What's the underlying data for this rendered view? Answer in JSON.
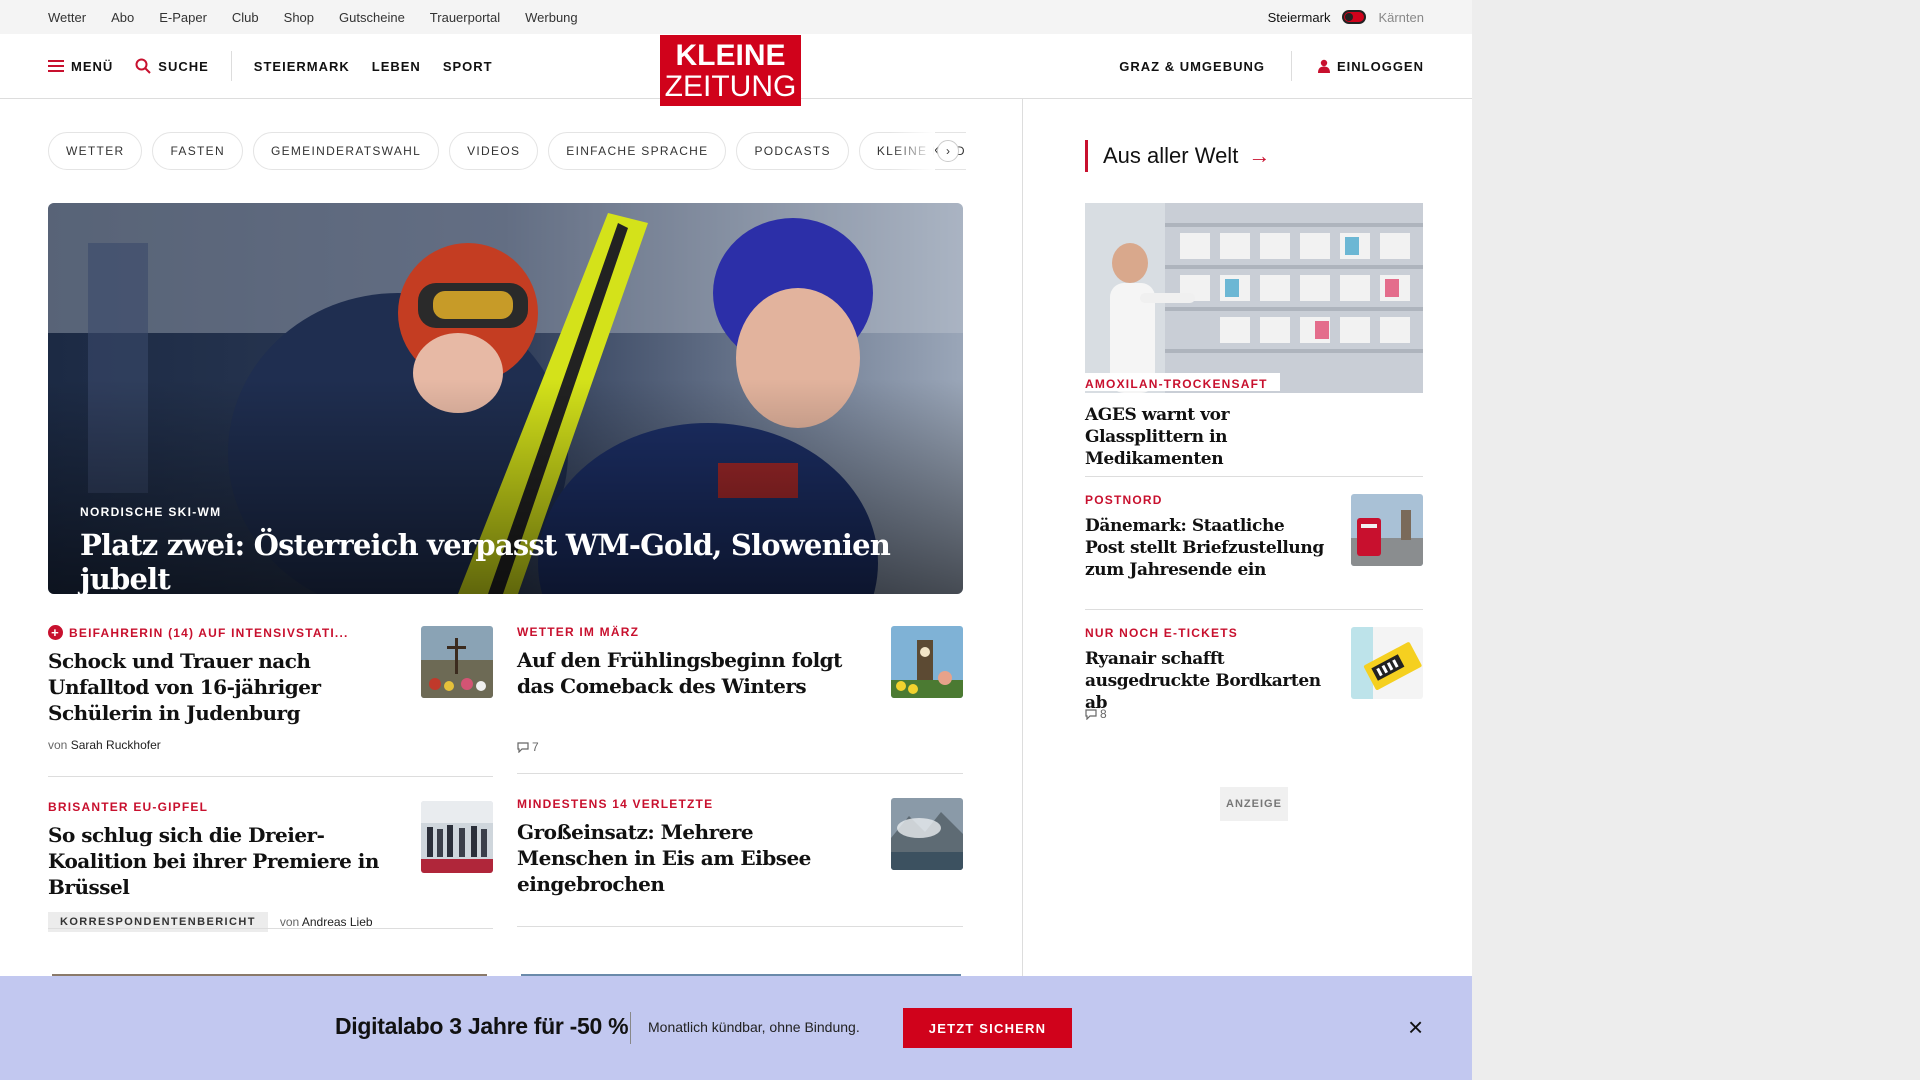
{
  "topbar": {
    "links": [
      "Wetter",
      "Abo",
      "E-Paper",
      "Club",
      "Shop",
      "Gutscheine",
      "Trauerportal",
      "Werbung"
    ],
    "region_active": "Steiermark",
    "region_other": "Kärnten"
  },
  "header": {
    "menu_label": "MENÜ",
    "search_label": "SUCHE",
    "nav": [
      "STEIERMARK",
      "LEBEN",
      "SPORT"
    ],
    "logo_line1": "KLEINE",
    "logo_line2": "ZEITUNG",
    "local_label": "GRAZ & UMGEBUNG",
    "login_label": "EINLOGGEN",
    "brand_color": "#d0021b"
  },
  "chips": [
    "WETTER",
    "FASTEN",
    "GEMEINDERATSWAHL",
    "VIDEOS",
    "EINFACHE SPRACHE",
    "PODCASTS",
    "KLEINE KINDER"
  ],
  "hero": {
    "kicker": "NORDISCHE SKI-WM",
    "title": "Platz zwei: Österreich verpasst WM-Gold, Slowenien jubelt"
  },
  "articles": [
    {
      "kicker": "BEIFAHRERIN (14) AUF INTENSIVSTATI...",
      "premium": true,
      "title": "Schock und Trauer nach Unfalltod von 16-jähriger Schülerin in Judenburg",
      "author_prefix": "von",
      "author": "Sarah Ruckhofer"
    },
    {
      "kicker": "WETTER IM MÄRZ",
      "title": "Auf den Frühlingsbeginn folgt das Comeback des Winters",
      "comments": "7"
    },
    {
      "kicker": "BRISANTER EU-GIPFEL",
      "title": "So schlug sich die Dreier-Koalition bei ihrer Premiere in Brüssel",
      "badge": "KORRESPONDENTENBERICHT",
      "author_prefix": "von",
      "author": "Andreas Lieb"
    },
    {
      "kicker": "MINDESTENS 14 VERLETZTE",
      "title": "Großeinsatz: Mehrere Menschen in Eis am Eibsee eingebrochen"
    }
  ],
  "rail": {
    "heading": "Aus aller Welt",
    "items": [
      {
        "kicker": "AMOXILAN-TROCKENSAFT",
        "title": "AGES warnt vor Glassplittern in Medikamenten"
      },
      {
        "kicker": "POSTNORD",
        "title": "Dänemark: Staatliche Post stellt Briefzustellung zum Jahresende ein"
      },
      {
        "kicker": "NUR NOCH E-TICKETS",
        "title": "Ryanair schafft ausgedruckte Bordkarten ab",
        "comments": "8"
      }
    ],
    "ad_label": "ANZEIGE"
  },
  "promo": {
    "headline": "Digitalabo 3 Jahre für -50 %",
    "subline": "Monatlich kündbar, ohne Bindung.",
    "cta": "JETZT SICHERN"
  }
}
